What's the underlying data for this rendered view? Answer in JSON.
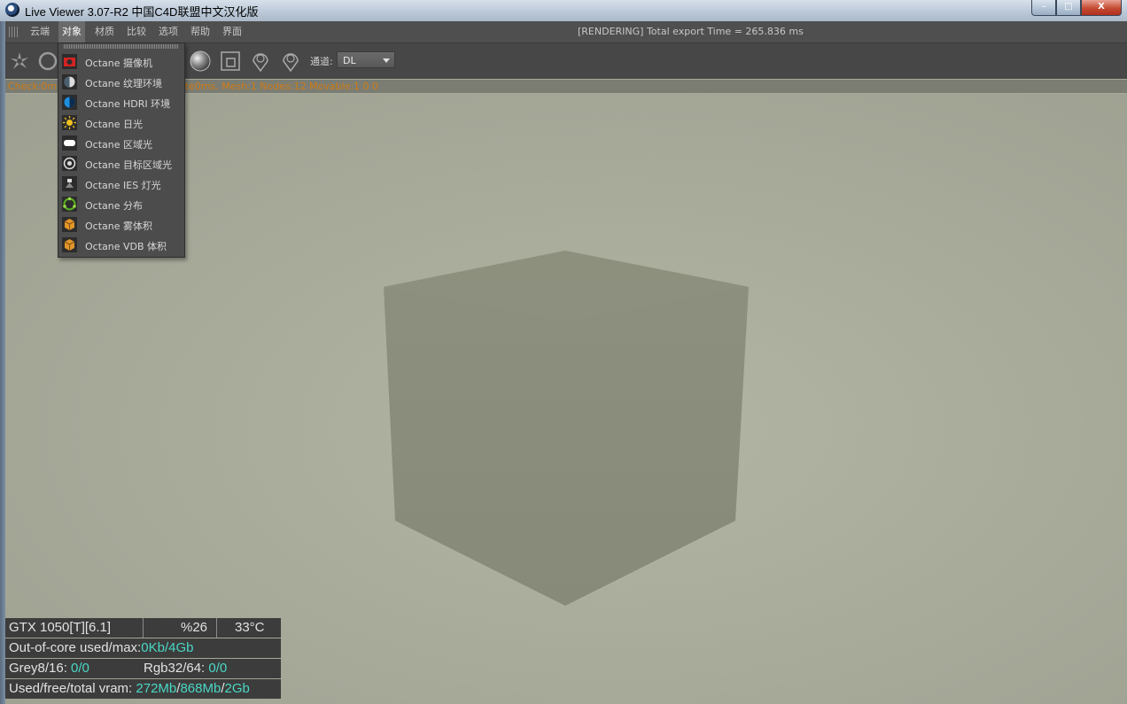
{
  "window": {
    "title": "Live Viewer 3.07-R2 中国C4D联盟中文汉化版",
    "min": "–",
    "max": "□",
    "close": "X"
  },
  "menu": {
    "items": [
      "云端",
      "对象",
      "材质",
      "比较",
      "选项",
      "帮助",
      "界面"
    ],
    "active": "对象",
    "render_status": "[RENDERING] Total export Time = 265.836 ms"
  },
  "toolbar": {
    "icons": [
      "octane-logo-icon",
      "restart-icon",
      "material-ball-icon",
      "region-icon",
      "focus-pick-icon",
      "material-pick-icon"
    ],
    "channel_label": "通道:",
    "channel_value": "DL"
  },
  "statusline": {
    "left": "Check:0ms",
    "right": "ate0ms. Mesh:1 Nodes:12 Movable:1  0 0"
  },
  "dropdown": {
    "items": [
      {
        "label": "Octane 摄像机",
        "icon": "camera-icon",
        "color": "#d42323"
      },
      {
        "label": "Octane 纹理环境",
        "icon": "texture-environment-icon",
        "color": "#8aa0b0"
      },
      {
        "label": "Octane HDRI 环境",
        "icon": "hdri-environment-icon",
        "color": "#1e8fe0"
      },
      {
        "label": "Octane 日光",
        "icon": "daylight-icon",
        "color": "#f0c020"
      },
      {
        "label": "Octane 区域光",
        "icon": "area-light-icon",
        "color": "#ffffff"
      },
      {
        "label": "Octane 目标区域光",
        "icon": "target-area-light-icon",
        "color": "#dddddd"
      },
      {
        "label": "Octane IES 灯光",
        "icon": "ies-light-icon",
        "color": "#dddddd"
      },
      {
        "label": "Octane 分布",
        "icon": "scatter-icon",
        "color": "#58b020"
      },
      {
        "label": "Octane 雾体积",
        "icon": "fog-volume-icon",
        "color": "#e0962a"
      },
      {
        "label": "Octane VDB 体积",
        "icon": "vdb-volume-icon",
        "color": "#e0962a"
      }
    ]
  },
  "hud": {
    "gpu": "GTX 1050[T][6.1]",
    "usage": "%26",
    "temp": "33°C",
    "ooc_label": "Out-of-core used/max:",
    "ooc_used": "0Kb",
    "slash": "/",
    "ooc_max": "4Gb",
    "grey_label": "Grey8/16: ",
    "grey_val": "0/0",
    "rgb_label": "Rgb32/64: ",
    "rgb_val": "0/0",
    "vram_label": "Used/free/total vram: ",
    "vram_used": "272Mb",
    "vram_free": "868Mb",
    "vram_total": "2Gb"
  },
  "colors": {
    "accent_value": "#49d8c5",
    "status_orange": "#d07a12"
  }
}
